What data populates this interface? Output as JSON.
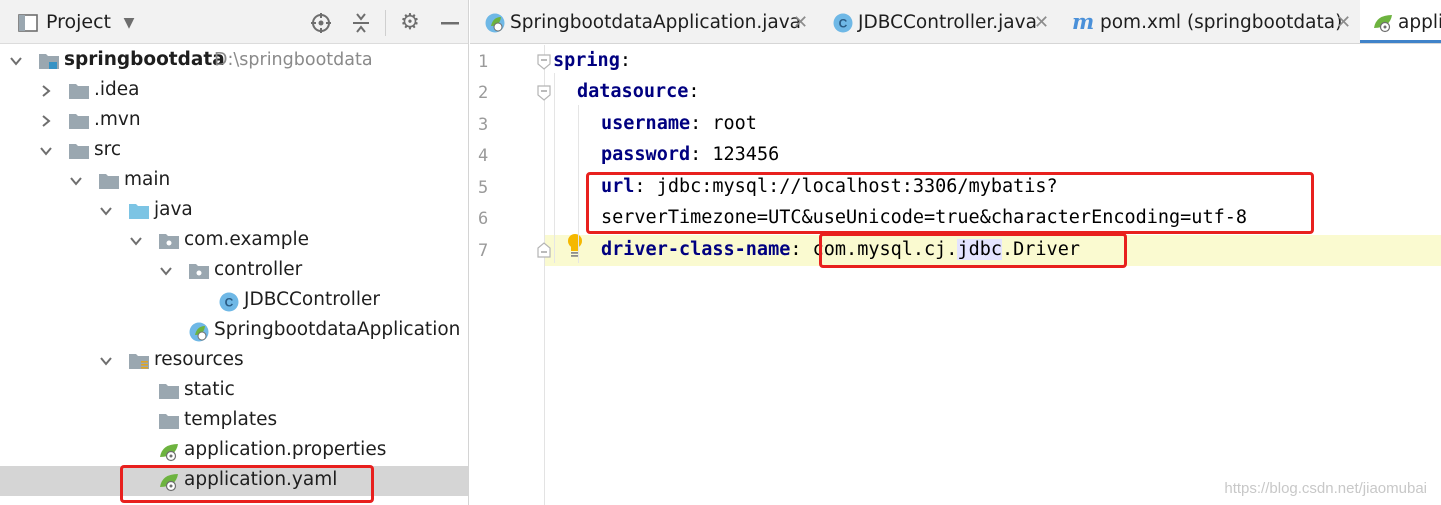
{
  "project_panel": {
    "title": "Project",
    "header_icons": [
      "locate-icon",
      "collapse-all-icon",
      "gear-icon",
      "minimize-icon"
    ],
    "tree": [
      {
        "label": "springbootdata",
        "path": "D:\\springbootdata",
        "type": "module",
        "expanded": true
      },
      {
        "label": ".idea",
        "type": "folder",
        "expanded": false
      },
      {
        "label": ".mvn",
        "type": "folder",
        "expanded": false
      },
      {
        "label": "src",
        "type": "folder",
        "expanded": true
      },
      {
        "label": "main",
        "type": "folder",
        "expanded": true
      },
      {
        "label": "java",
        "type": "source-folder",
        "expanded": true
      },
      {
        "label": "com.example",
        "type": "package",
        "expanded": true
      },
      {
        "label": "controller",
        "type": "package",
        "expanded": true
      },
      {
        "label": "JDBCController",
        "type": "class"
      },
      {
        "label": "SpringbootdataApplication",
        "type": "spring-boot-class"
      },
      {
        "label": "resources",
        "type": "resources-folder",
        "expanded": true
      },
      {
        "label": "static",
        "type": "folder"
      },
      {
        "label": "templates",
        "type": "folder"
      },
      {
        "label": "application.properties",
        "type": "spring-config"
      },
      {
        "label": "application.yaml",
        "type": "spring-config",
        "selected": true
      }
    ]
  },
  "tabs": [
    {
      "label": "SpringbootdataApplication.java",
      "icon": "spring-boot-class-icon",
      "closable": true
    },
    {
      "label": "JDBCController.java",
      "icon": "class-icon",
      "closable": true
    },
    {
      "label": "pom.xml (springbootdata)",
      "icon": "maven-icon",
      "closable": true
    },
    {
      "label": "appli",
      "icon": "spring-config-icon",
      "active": true
    }
  ],
  "editor": {
    "line_numbers": [
      "1",
      "2",
      "3",
      "4",
      "5",
      "6",
      "7"
    ],
    "lines": {
      "l1_key": "spring",
      "l2_key": "datasource",
      "l3_key": "username",
      "l3_val": "root",
      "l4_key": "password",
      "l4_val": "123456",
      "l5_key": "url",
      "l5_val": "jdbc:mysql://localhost:3306/mybatis?",
      "l6_val": "serverTimezone=UTC&useUnicode=true&characterEncoding=utf-8",
      "l7_key": "driver-class-name",
      "l7_val_a": "com.mysql.cj.",
      "l7_val_b": "jdbc",
      "l7_val_c": ".Driver"
    },
    "colon": ":"
  },
  "watermark": "https://blog.csdn.net/jiaomubai",
  "colors": {
    "accent": "#4083c9",
    "highlight_box": "#e8201e",
    "yaml_key": "#000080",
    "selected_row": "#d5d5d5",
    "caret_line": "#fafad0"
  }
}
